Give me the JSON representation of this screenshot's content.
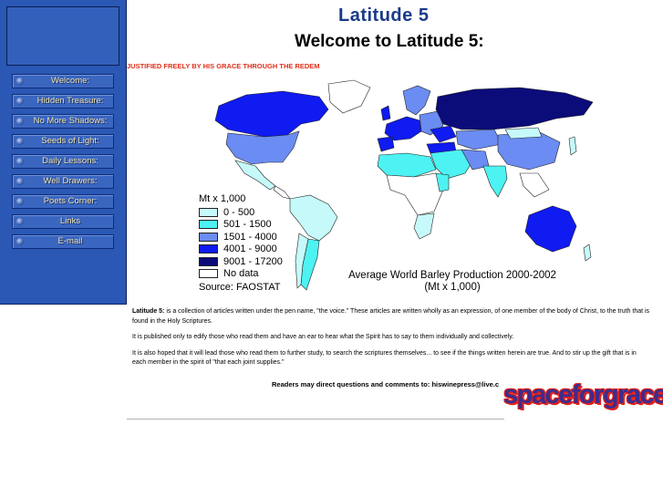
{
  "header": {
    "brand": "Latitude 5",
    "welcome": "Welcome to Latitude 5:",
    "marquee": "JUSTIFIED FREELY BY HIS GRACE THROUGH THE REDEM"
  },
  "sidebar": {
    "items": [
      {
        "label": "Welcome:"
      },
      {
        "label": "Hidden Treasure:"
      },
      {
        "label": "No More Shadows:"
      },
      {
        "label": "Seeds of Light:"
      },
      {
        "label": "Daily Lessons:"
      },
      {
        "label": "Well Drawers:"
      },
      {
        "label": "Poets Corner:"
      },
      {
        "label": "Links"
      },
      {
        "label": "E-mail"
      }
    ]
  },
  "map": {
    "legend_title": "Mt x 1,000",
    "legend": [
      {
        "label": "0 - 500",
        "color": "#c6fafa"
      },
      {
        "label": "501 - 1500",
        "color": "#4df2f2"
      },
      {
        "label": "1501 - 4000",
        "color": "#6b8cf2"
      },
      {
        "label": "4001 - 9000",
        "color": "#0f1bf0"
      },
      {
        "label": "9001 - 17200",
        "color": "#0b0b7a"
      },
      {
        "label": "No data",
        "color": "#ffffff"
      }
    ],
    "source": "Source: FAOSTAT",
    "caption_line1": "Average World Barley Production  2000-2002",
    "caption_line2": "(Mt x 1,000)"
  },
  "content": {
    "p1_bold": "Latitude 5:",
    "p1": " is a collection of articles written under the pen name, \"the voice.\" These articles are written wholly as an expression, of one member of the body of Christ, to the truth that is found in the Holy Scriptures.",
    "p2": "It is published only to edify those who read them and have an ear to hear what the Spirit has to say to them individually and collectively.",
    "p3": "It is also hoped that it will lead those who read them to further study, to search the scriptures themselves... to see if the things written herein are true. And to stir up the gift that is in each member in the spirit of \"that each joint supplies.\"",
    "contact": "Readers may direct questions and comments to: hiswinepress@live.c"
  },
  "banner": {
    "text": "spaceforgrace"
  }
}
